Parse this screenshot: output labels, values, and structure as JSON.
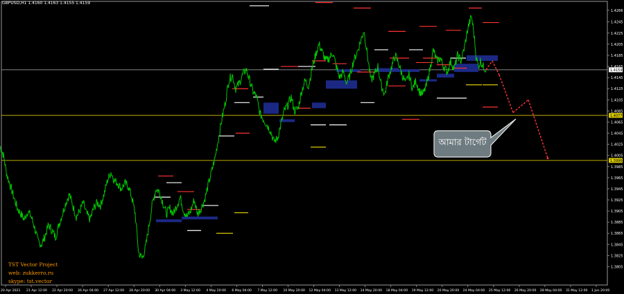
{
  "header": {
    "text": "GBPUSD,H1  1.4160 1.4163 1.4155 1.4159"
  },
  "watermark": {
    "line1": "TST Vector Project",
    "line2": "web: zukkerro.ru",
    "line3": "skype: tst.vector"
  },
  "callout": {
    "text": "আমার টার্গেট"
  },
  "colors": {
    "background": "#000000",
    "candles": "#00c800",
    "projection": "#ff3333",
    "zone": "#1c2a8a",
    "hline_gray": "#b4b4b4",
    "hline_yellow": "#d8c800",
    "grid": "#454545",
    "text": "#ffffff"
  },
  "chart_data": {
    "type": "line",
    "symbol": "GBPUSD",
    "timeframe": "H1",
    "ylim": [
      1.3772,
      1.4282
    ],
    "price_ticks": [
      "1.4266",
      "1.4245",
      "1.4225",
      "1.4205",
      "1.4185",
      "1.4165",
      "1.4145",
      "1.4125",
      "1.4105",
      "1.4085",
      "1.4065",
      "1.4045",
      "1.4025",
      "1.4005",
      "1.3985",
      "1.3965",
      "1.3945",
      "1.3925",
      "1.3905",
      "1.3885",
      "1.3865",
      "1.3845",
      "1.3825",
      "1.3805"
    ],
    "current_price_label": "1.4159",
    "level_labels": [
      {
        "price": 1.4077,
        "text": "1.4077",
        "color": "#d8c800"
      },
      {
        "price": 1.3996,
        "text": "1.3996",
        "color": "#d8c800"
      }
    ],
    "time_ticks": [
      "20 Apr 2021",
      "21 Apr 12:00",
      "22 Apr 20:00",
      "26 Apr 04:00",
      "27 Apr 12:00",
      "28 Apr 20:00",
      "30 Apr 04:00",
      "3 May 12:00",
      "4 May 20:00",
      "6 May 04:00",
      "7 May 12:00",
      "10 May 20:00",
      "12 May 04:00",
      "13 May 12:00",
      "14 May 20:00",
      "18 May 04:00",
      "19 May 12:00",
      "20 May 20:00",
      "24 May 04:00",
      "25 May 12:00",
      "26 May 20:00",
      "28 May 04:00",
      "31 May 12:00",
      "1 Jun 20:00"
    ],
    "price_path": [
      [
        0,
        1.4022
      ],
      [
        5,
        1.4005
      ],
      [
        10,
        1.397
      ],
      [
        15,
        1.395
      ],
      [
        20,
        1.393
      ],
      [
        25,
        1.391
      ],
      [
        30,
        1.39
      ],
      [
        35,
        1.389
      ],
      [
        40,
        1.3905
      ],
      [
        45,
        1.3895
      ],
      [
        50,
        1.3875
      ],
      [
        55,
        1.385
      ],
      [
        60,
        1.3845
      ],
      [
        65,
        1.386
      ],
      [
        70,
        1.388
      ],
      [
        75,
        1.387
      ],
      [
        80,
        1.3858
      ],
      [
        85,
        1.388
      ],
      [
        90,
        1.39
      ],
      [
        95,
        1.392
      ],
      [
        100,
        1.3935
      ],
      [
        105,
        1.3915
      ],
      [
        110,
        1.3895
      ],
      [
        115,
        1.3905
      ],
      [
        120,
        1.392
      ],
      [
        125,
        1.39
      ],
      [
        130,
        1.389
      ],
      [
        135,
        1.391
      ],
      [
        140,
        1.392
      ],
      [
        145,
        1.3915
      ],
      [
        150,
        1.3935
      ],
      [
        155,
        1.396
      ],
      [
        160,
        1.3975
      ],
      [
        165,
        1.396
      ],
      [
        170,
        1.3955
      ],
      [
        175,
        1.3945
      ],
      [
        180,
        1.3955
      ],
      [
        185,
        1.395
      ],
      [
        190,
        1.393
      ],
      [
        195,
        1.39
      ],
      [
        200,
        1.383
      ],
      [
        205,
        1.382
      ],
      [
        210,
        1.384
      ],
      [
        215,
        1.388
      ],
      [
        220,
        1.392
      ],
      [
        225,
        1.3945
      ],
      [
        230,
        1.394
      ],
      [
        235,
        1.392
      ],
      [
        240,
        1.39
      ],
      [
        245,
        1.391
      ],
      [
        250,
        1.39
      ],
      [
        255,
        1.3915
      ],
      [
        260,
        1.393
      ],
      [
        265,
        1.3905
      ],
      [
        270,
        1.3895
      ],
      [
        275,
        1.3905
      ],
      [
        280,
        1.3925
      ],
      [
        285,
        1.39
      ],
      [
        290,
        1.391
      ],
      [
        295,
        1.3925
      ],
      [
        300,
        1.395
      ],
      [
        305,
        1.3975
      ],
      [
        310,
        1.4
      ],
      [
        315,
        1.4035
      ],
      [
        320,
        1.407
      ],
      [
        325,
        1.41
      ],
      [
        330,
        1.414
      ],
      [
        335,
        1.415
      ],
      [
        340,
        1.4125
      ],
      [
        345,
        1.4135
      ],
      [
        350,
        1.415
      ],
      [
        355,
        1.416
      ],
      [
        360,
        1.414
      ],
      [
        365,
        1.412
      ],
      [
        370,
        1.411
      ],
      [
        375,
        1.408
      ],
      [
        380,
        1.407
      ],
      [
        385,
        1.406
      ],
      [
        390,
        1.405
      ],
      [
        395,
        1.403
      ],
      [
        400,
        1.4035
      ],
      [
        405,
        1.406
      ],
      [
        410,
        1.4085
      ],
      [
        415,
        1.4095
      ],
      [
        420,
        1.411
      ],
      [
        425,
        1.4085
      ],
      [
        430,
        1.409
      ],
      [
        435,
        1.412
      ],
      [
        440,
        1.414
      ],
      [
        445,
        1.413
      ],
      [
        450,
        1.416
      ],
      [
        455,
        1.4185
      ],
      [
        460,
        1.4205
      ],
      [
        465,
        1.419
      ],
      [
        470,
        1.4175
      ],
      [
        475,
        1.418
      ],
      [
        480,
        1.419
      ],
      [
        485,
        1.4165
      ],
      [
        490,
        1.4145
      ],
      [
        495,
        1.4155
      ],
      [
        500,
        1.4135
      ],
      [
        505,
        1.415
      ],
      [
        510,
        1.4175
      ],
      [
        515,
        1.419
      ],
      [
        520,
        1.421
      ],
      [
        525,
        1.423
      ],
      [
        530,
        1.4185
      ],
      [
        535,
        1.414
      ],
      [
        540,
        1.415
      ],
      [
        545,
        1.4165
      ],
      [
        550,
        1.413
      ],
      [
        555,
        1.4115
      ],
      [
        560,
        1.4145
      ],
      [
        565,
        1.4165
      ],
      [
        570,
        1.4185
      ],
      [
        575,
        1.417
      ],
      [
        580,
        1.415
      ],
      [
        585,
        1.4135
      ],
      [
        590,
        1.415
      ],
      [
        595,
        1.4125
      ],
      [
        600,
        1.414
      ],
      [
        605,
        1.412
      ],
      [
        610,
        1.4115
      ],
      [
        615,
        1.413
      ],
      [
        620,
        1.416
      ],
      [
        625,
        1.4195
      ],
      [
        630,
        1.4175
      ],
      [
        635,
        1.418
      ],
      [
        640,
        1.4165
      ],
      [
        645,
        1.4155
      ],
      [
        650,
        1.4175
      ],
      [
        655,
        1.416
      ],
      [
        660,
        1.4185
      ],
      [
        665,
        1.4175
      ],
      [
        670,
        1.42
      ],
      [
        675,
        1.4235
      ],
      [
        680,
        1.4255
      ],
      [
        683,
        1.423
      ],
      [
        687,
        1.418
      ],
      [
        690,
        1.4165
      ],
      [
        693,
        1.4175
      ],
      [
        697,
        1.4165
      ],
      [
        701,
        1.4159
      ]
    ],
    "projection_path": [
      [
        701,
        1.4159
      ],
      [
        710,
        1.4175
      ],
      [
        720,
        1.415
      ],
      [
        740,
        1.4082
      ],
      [
        762,
        1.4105
      ],
      [
        790,
        1.4
      ]
    ],
    "grid": false,
    "legend": "none"
  },
  "overlay": {
    "hlines": [
      {
        "price": 1.4159,
        "color": "#b4b4b4"
      },
      {
        "price": 1.4077,
        "color": "#d8c800"
      },
      {
        "price": 1.3996,
        "color": "#d8c800"
      }
    ],
    "zones": [
      [
        225,
        1.389,
        262,
        1.3885
      ],
      [
        262,
        1.3895,
        314,
        1.389
      ],
      [
        380,
        1.41,
        402,
        1.408
      ],
      [
        403,
        1.407,
        425,
        1.4065
      ],
      [
        450,
        1.41,
        470,
        1.409
      ],
      [
        470,
        1.414,
        515,
        1.4125
      ],
      [
        485,
        1.416,
        520,
        1.4155
      ],
      [
        540,
        1.4162,
        575,
        1.4155
      ],
      [
        575,
        1.416,
        605,
        1.4155
      ],
      [
        605,
        1.4142,
        630,
        1.4138
      ],
      [
        630,
        1.4152,
        655,
        1.4145
      ],
      [
        655,
        1.417,
        690,
        1.4155
      ],
      [
        673,
        1.4185,
        718,
        1.4175
      ]
    ],
    "ticks": [
      [
        360,
        388,
        1.4274,
        "#ffffff"
      ],
      [
        455,
        480,
        1.428,
        "#ff3333"
      ],
      [
        510,
        535,
        1.427,
        "#ff3333"
      ],
      [
        228,
        250,
        1.3968,
        "#ff3333"
      ],
      [
        240,
        262,
        1.3956,
        "#ffffff"
      ],
      [
        222,
        246,
        1.393,
        "#ffffff"
      ],
      [
        256,
        280,
        1.394,
        "#ff3333"
      ],
      [
        270,
        290,
        1.3908,
        "#ff3333"
      ],
      [
        292,
        315,
        1.3915,
        "#ffffff"
      ],
      [
        335,
        358,
        1.4125,
        "#ff3333"
      ],
      [
        338,
        360,
        1.41,
        "#ffffff"
      ],
      [
        315,
        338,
        1.404,
        "#ffffff"
      ],
      [
        340,
        360,
        1.4045,
        "#ff3333"
      ],
      [
        365,
        380,
        1.411,
        "#ffffff"
      ],
      [
        380,
        402,
        1.416,
        "#ffffff"
      ],
      [
        405,
        430,
        1.4165,
        "#ff3333"
      ],
      [
        430,
        455,
        1.4165,
        "#ffffff"
      ],
      [
        450,
        470,
        1.4175,
        "#ff3333"
      ],
      [
        430,
        448,
        1.409,
        "#ff3333"
      ],
      [
        448,
        470,
        1.406,
        "#ffffff"
      ],
      [
        475,
        500,
        1.406,
        "#ffffff"
      ],
      [
        480,
        500,
        1.417,
        "#ff3333"
      ],
      [
        515,
        540,
        1.4155,
        "#ff3333"
      ],
      [
        520,
        540,
        1.41,
        "#ffffff"
      ],
      [
        540,
        560,
        1.4195,
        "#ffffff"
      ],
      [
        562,
        590,
        1.418,
        "#ff3333"
      ],
      [
        560,
        585,
        1.413,
        "#ff3333"
      ],
      [
        590,
        610,
        1.4195,
        "#ffffff"
      ],
      [
        600,
        625,
        1.4172,
        "#ff3333"
      ],
      [
        630,
        650,
        1.4168,
        "#ff3333"
      ],
      [
        650,
        672,
        1.418,
        "#ffffff"
      ],
      [
        560,
        585,
        1.4228,
        "#ff3333"
      ],
      [
        605,
        630,
        1.4237,
        "#ff3333"
      ],
      [
        643,
        665,
        1.423,
        "#ff3333"
      ],
      [
        676,
        695,
        1.427,
        "#ff3333"
      ],
      [
        696,
        720,
        1.4244,
        "#ff3333"
      ],
      [
        610,
        635,
        1.418,
        "#ff3333"
      ],
      [
        655,
        673,
        1.4162,
        "#ff3333"
      ],
      [
        630,
        655,
        1.4108,
        "#ffffff"
      ],
      [
        655,
        673,
        1.4108,
        "#ffffff"
      ],
      [
        672,
        695,
        1.4132,
        "#d8c800"
      ],
      [
        696,
        718,
        1.4132,
        "#d8c800"
      ],
      [
        696,
        718,
        1.4092,
        "#ff3333"
      ],
      [
        580,
        605,
        1.407,
        "#ff3333"
      ],
      [
        448,
        470,
        1.402,
        "#d8c800"
      ],
      [
        338,
        358,
        1.3902,
        "#d8c800"
      ],
      [
        312,
        336,
        1.3865,
        "#d8c800"
      ],
      [
        270,
        290,
        1.387,
        "#ffffff"
      ]
    ]
  }
}
